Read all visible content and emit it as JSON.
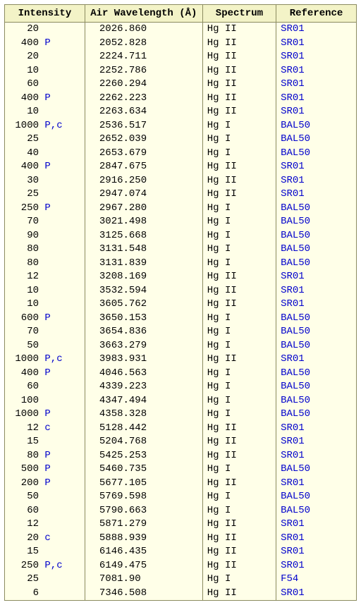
{
  "headers": {
    "intensity": "Intensity",
    "wavelength": "Air\nWavelength (Å)",
    "spectrum": "Spectrum",
    "reference": "Reference"
  },
  "rows": [
    {
      "intensity": "20",
      "flag": "",
      "wavelength": "2026.860",
      "spectrum": "Hg II",
      "reference": "SR01"
    },
    {
      "intensity": "400",
      "flag": "P",
      "wavelength": "2052.828",
      "spectrum": "Hg II",
      "reference": "SR01"
    },
    {
      "intensity": "20",
      "flag": "",
      "wavelength": "2224.711",
      "spectrum": "Hg II",
      "reference": "SR01"
    },
    {
      "intensity": "10",
      "flag": "",
      "wavelength": "2252.786",
      "spectrum": "Hg II",
      "reference": "SR01"
    },
    {
      "intensity": "60",
      "flag": "",
      "wavelength": "2260.294",
      "spectrum": "Hg II",
      "reference": "SR01"
    },
    {
      "intensity": "400",
      "flag": "P",
      "wavelength": "2262.223",
      "spectrum": "Hg II",
      "reference": "SR01"
    },
    {
      "intensity": "10",
      "flag": "",
      "wavelength": "2263.634",
      "spectrum": "Hg II",
      "reference": "SR01"
    },
    {
      "intensity": "1000",
      "flag": "P,c",
      "wavelength": "2536.517",
      "spectrum": "Hg I",
      "reference": "BAL50"
    },
    {
      "intensity": "25",
      "flag": "",
      "wavelength": "2652.039",
      "spectrum": "Hg I",
      "reference": "BAL50"
    },
    {
      "intensity": "40",
      "flag": "",
      "wavelength": "2653.679",
      "spectrum": "Hg I",
      "reference": "BAL50"
    },
    {
      "intensity": "400",
      "flag": "P",
      "wavelength": "2847.675",
      "spectrum": "Hg II",
      "reference": "SR01"
    },
    {
      "intensity": "30",
      "flag": "",
      "wavelength": "2916.250",
      "spectrum": "Hg II",
      "reference": "SR01"
    },
    {
      "intensity": "25",
      "flag": "",
      "wavelength": "2947.074",
      "spectrum": "Hg II",
      "reference": "SR01"
    },
    {
      "intensity": "250",
      "flag": "P",
      "wavelength": "2967.280",
      "spectrum": "Hg I",
      "reference": "BAL50"
    },
    {
      "intensity": "70",
      "flag": "",
      "wavelength": "3021.498",
      "spectrum": "Hg I",
      "reference": "BAL50"
    },
    {
      "intensity": "90",
      "flag": "",
      "wavelength": "3125.668",
      "spectrum": "Hg I",
      "reference": "BAL50"
    },
    {
      "intensity": "80",
      "flag": "",
      "wavelength": "3131.548",
      "spectrum": "Hg I",
      "reference": "BAL50"
    },
    {
      "intensity": "80",
      "flag": "",
      "wavelength": "3131.839",
      "spectrum": "Hg I",
      "reference": "BAL50"
    },
    {
      "intensity": "12",
      "flag": "",
      "wavelength": "3208.169",
      "spectrum": "Hg II",
      "reference": "SR01"
    },
    {
      "intensity": "10",
      "flag": "",
      "wavelength": "3532.594",
      "spectrum": "Hg II",
      "reference": "SR01"
    },
    {
      "intensity": "10",
      "flag": "",
      "wavelength": "3605.762",
      "spectrum": "Hg II",
      "reference": "SR01"
    },
    {
      "intensity": "600",
      "flag": "P",
      "wavelength": "3650.153",
      "spectrum": "Hg I",
      "reference": "BAL50"
    },
    {
      "intensity": "70",
      "flag": "",
      "wavelength": "3654.836",
      "spectrum": "Hg I",
      "reference": "BAL50"
    },
    {
      "intensity": "50",
      "flag": "",
      "wavelength": "3663.279",
      "spectrum": "Hg I",
      "reference": "BAL50"
    },
    {
      "intensity": "1000",
      "flag": "P,c",
      "wavelength": "3983.931",
      "spectrum": "Hg II",
      "reference": "SR01"
    },
    {
      "intensity": "400",
      "flag": "P",
      "wavelength": "4046.563",
      "spectrum": "Hg I",
      "reference": "BAL50"
    },
    {
      "intensity": "60",
      "flag": "",
      "wavelength": "4339.223",
      "spectrum": "Hg I",
      "reference": "BAL50"
    },
    {
      "intensity": "100",
      "flag": "",
      "wavelength": "4347.494",
      "spectrum": "Hg I",
      "reference": "BAL50"
    },
    {
      "intensity": "1000",
      "flag": "P",
      "wavelength": "4358.328",
      "spectrum": "Hg I",
      "reference": "BAL50"
    },
    {
      "intensity": "12",
      "flag": "c",
      "wavelength": "5128.442",
      "spectrum": "Hg II",
      "reference": "SR01"
    },
    {
      "intensity": "15",
      "flag": "",
      "wavelength": "5204.768",
      "spectrum": "Hg II",
      "reference": "SR01"
    },
    {
      "intensity": "80",
      "flag": "P",
      "wavelength": "5425.253",
      "spectrum": "Hg II",
      "reference": "SR01"
    },
    {
      "intensity": "500",
      "flag": "P",
      "wavelength": "5460.735",
      "spectrum": "Hg I",
      "reference": "BAL50"
    },
    {
      "intensity": "200",
      "flag": "P",
      "wavelength": "5677.105",
      "spectrum": "Hg II",
      "reference": "SR01"
    },
    {
      "intensity": "50",
      "flag": "",
      "wavelength": "5769.598",
      "spectrum": "Hg I",
      "reference": "BAL50"
    },
    {
      "intensity": "60",
      "flag": "",
      "wavelength": "5790.663",
      "spectrum": "Hg I",
      "reference": "BAL50"
    },
    {
      "intensity": "12",
      "flag": "",
      "wavelength": "5871.279",
      "spectrum": "Hg II",
      "reference": "SR01"
    },
    {
      "intensity": "20",
      "flag": "c",
      "wavelength": "5888.939",
      "spectrum": "Hg II",
      "reference": "SR01"
    },
    {
      "intensity": "15",
      "flag": "",
      "wavelength": "6146.435",
      "spectrum": "Hg II",
      "reference": "SR01"
    },
    {
      "intensity": "250",
      "flag": "P,c",
      "wavelength": "6149.475",
      "spectrum": "Hg II",
      "reference": "SR01"
    },
    {
      "intensity": "25",
      "flag": "",
      "wavelength": "7081.90",
      "spectrum": "Hg I",
      "reference": "F54"
    },
    {
      "intensity": "6",
      "flag": "",
      "wavelength": "7346.508",
      "spectrum": "Hg II",
      "reference": "SR01"
    }
  ]
}
